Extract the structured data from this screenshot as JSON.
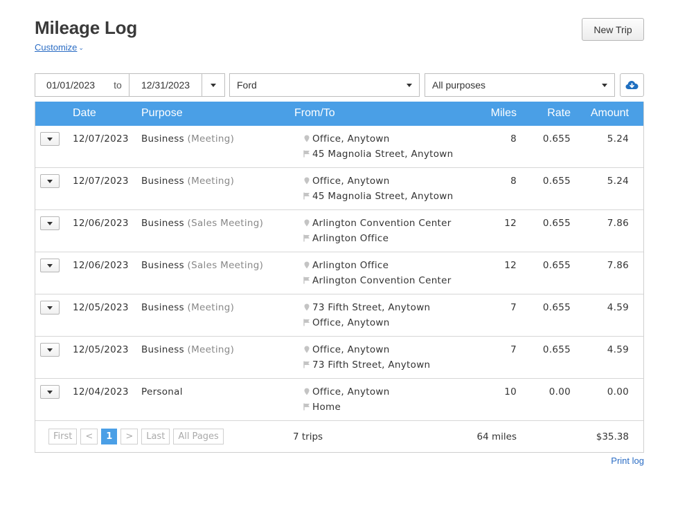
{
  "header": {
    "title": "Mileage Log",
    "customize_label": "Customize",
    "new_trip_label": "New Trip"
  },
  "filters": {
    "date_from": "01/01/2023",
    "to_label": "to",
    "date_to": "12/31/2023",
    "vehicle": "Ford",
    "purpose": "All purposes",
    "download_icon": "cloud-download-icon"
  },
  "table": {
    "columns": {
      "date": "Date",
      "purpose": "Purpose",
      "from_to": "From/To",
      "miles": "Miles",
      "rate": "Rate",
      "amount": "Amount"
    },
    "rows": [
      {
        "date": "12/07/2023",
        "purpose": "Business",
        "sub": "(Meeting)",
        "from": "Office, Anytown",
        "to": "45 Magnolia Street, Anytown",
        "miles": "8",
        "rate": "0.655",
        "amount": "5.24"
      },
      {
        "date": "12/07/2023",
        "purpose": "Business",
        "sub": "(Meeting)",
        "from": "Office, Anytown",
        "to": "45 Magnolia Street, Anytown",
        "miles": "8",
        "rate": "0.655",
        "amount": "5.24"
      },
      {
        "date": "12/06/2023",
        "purpose": "Business",
        "sub": "(Sales Meeting)",
        "from": "Arlington Convention Center",
        "to": "Arlington Office",
        "miles": "12",
        "rate": "0.655",
        "amount": "7.86"
      },
      {
        "date": "12/06/2023",
        "purpose": "Business",
        "sub": "(Sales Meeting)",
        "from": "Arlington Office",
        "to": "Arlington Convention Center",
        "miles": "12",
        "rate": "0.655",
        "amount": "7.86"
      },
      {
        "date": "12/05/2023",
        "purpose": "Business",
        "sub": "(Meeting)",
        "from": "73 Fifth Street, Anytown",
        "to": "Office, Anytown",
        "miles": "7",
        "rate": "0.655",
        "amount": "4.59"
      },
      {
        "date": "12/05/2023",
        "purpose": "Business",
        "sub": "(Meeting)",
        "from": "Office, Anytown",
        "to": "73 Fifth Street, Anytown",
        "miles": "7",
        "rate": "0.655",
        "amount": "4.59"
      },
      {
        "date": "12/04/2023",
        "purpose": "Personal",
        "sub": "",
        "from": "Office, Anytown",
        "to": "Home",
        "miles": "10",
        "rate": "0.00",
        "amount": "0.00"
      }
    ]
  },
  "pagination": {
    "first": "First",
    "prev": "<",
    "current": "1",
    "next": ">",
    "last": "Last",
    "all": "All Pages"
  },
  "totals": {
    "trips": "7 trips",
    "miles": "64 miles",
    "amount": "$35.38"
  },
  "footer": {
    "print_log": "Print log"
  },
  "colors": {
    "header_blue": "#4a9fe6",
    "link_blue": "#2a6cc4"
  }
}
